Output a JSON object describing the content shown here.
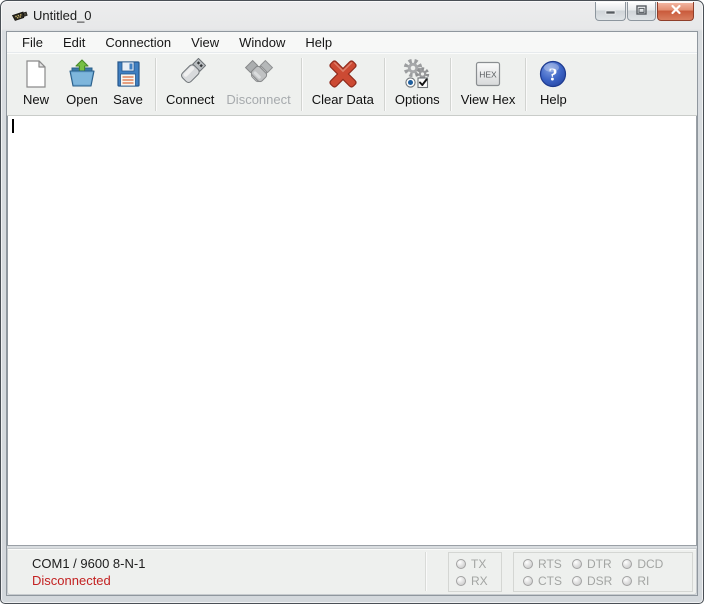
{
  "window": {
    "title": "Untitled_0",
    "app_icon": "serial-connector-icon",
    "controls": [
      {
        "name": "minimize-button",
        "icon": "minimize-icon"
      },
      {
        "name": "maximize-button",
        "icon": "maximize-icon"
      },
      {
        "name": "close-button",
        "icon": "close-icon"
      }
    ]
  },
  "menu": {
    "items": [
      "File",
      "Edit",
      "Connection",
      "View",
      "Window",
      "Help"
    ]
  },
  "toolbar": {
    "items": [
      {
        "label": "New",
        "icon": "new-document-icon",
        "enabled": true
      },
      {
        "label": "Open",
        "icon": "open-folder-icon",
        "enabled": true
      },
      {
        "label": "Save",
        "icon": "save-floppy-icon",
        "enabled": true
      },
      {
        "label": "Connect",
        "icon": "usb-connect-icon",
        "enabled": true
      },
      {
        "label": "Disconnect",
        "icon": "usb-disconnect-icon",
        "enabled": false
      },
      {
        "label": "Clear Data",
        "icon": "clear-data-x-icon",
        "enabled": true
      },
      {
        "label": "Options",
        "icon": "options-gears-icon",
        "enabled": true
      },
      {
        "label": "View Hex",
        "icon": "hex-button-icon",
        "icon_text": "HEX",
        "enabled": true
      },
      {
        "label": "Help",
        "icon": "help-question-icon",
        "icon_text": "?",
        "enabled": true
      }
    ]
  },
  "editor": {
    "content": ""
  },
  "statusbar": {
    "port_info": "COM1 / 9600 8-N-1",
    "connection_status": "Disconnected",
    "leds": [
      "TX",
      "RX",
      "RTS",
      "CTS",
      "DTR",
      "DSR",
      "DCD",
      "RI"
    ]
  },
  "colors": {
    "disconnected_text": "#c32222",
    "close_button": "#c95a3b",
    "toolbar_bg": "#eef0ee",
    "frame": "#d9dde0"
  }
}
